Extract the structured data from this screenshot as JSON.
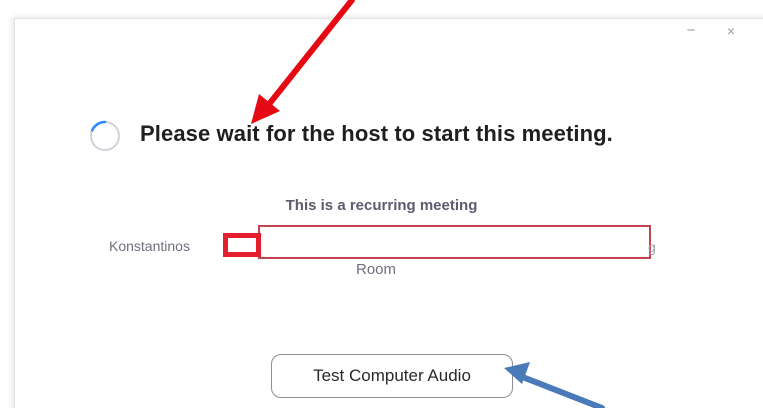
{
  "window": {
    "minimize_label": "−",
    "close_label": "×"
  },
  "status": {
    "message": "Please wait for the host to start this meeting.",
    "spinner_icon": "loading-spinner-icon"
  },
  "meeting": {
    "recurring_label": "This is a recurring meeting",
    "host_name": "Konstantinos",
    "trailing_text": "g",
    "room_label": "Room"
  },
  "actions": {
    "test_audio_label": "Test Computer Audio"
  },
  "colors": {
    "spinner_arc": "#2d8cff",
    "spinner_track": "#cfd3d9",
    "red_annotation": "#e50914",
    "blue_annotation": "#4a7ab8",
    "redaction_border": "#c1444e"
  },
  "annotations": {
    "arrows": [
      "red-arrow-pointing-at-message",
      "blue-arrow-pointing-at-test-audio-button"
    ]
  }
}
